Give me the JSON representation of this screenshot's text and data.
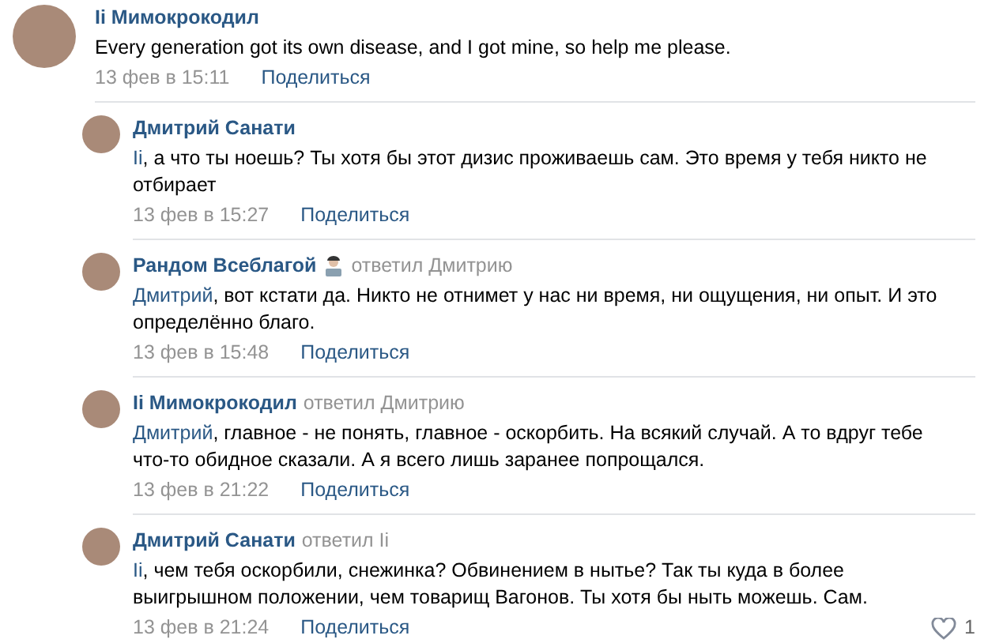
{
  "comments": [
    {
      "author": "Ii Мимокрокодил",
      "emoji": false,
      "text": "Every generation got its own disease, and I got mine, so help me please.",
      "date": "13 фев в 15:11",
      "share": "Поделиться",
      "nested": false
    },
    {
      "author": "Дмитрий Санати",
      "emoji": false,
      "addressee": "Ii",
      "text": ", а что ты ноешь? Ты хотя бы этот дизис проживаешь сам. Это время у тебя никто не отбирает",
      "date": "13 фев в 15:27",
      "share": "Поделиться",
      "nested": true
    },
    {
      "author": "Рандом Всеблагой",
      "reply_to": "ответил Дмитрию",
      "emoji": true,
      "addressee": "Дмитрий",
      "text": ", вот кстати да. Никто не отнимет у нас ни время, ни ощущения, ни опыт. И это определённо благо.",
      "date": "13 фев в 15:48",
      "share": "Поделиться",
      "nested": true
    },
    {
      "author": "Ii Мимокрокодил",
      "reply_to": "ответил Дмитрию",
      "emoji": false,
      "addressee": "Дмитрий",
      "text": ", главное - не понять, главное - оскорбить. На всякий случай. А то вдруг тебе что-то обидное сказали. А я всего лишь заранее попрощался.",
      "date": "13 фев в 21:22",
      "share": "Поделиться",
      "nested": true
    },
    {
      "author": "Дмитрий Санати",
      "reply_to": "ответил Ii",
      "emoji": false,
      "addressee": "Ii",
      "text": ", чем тебя оскорбили, снежинка? Обвинением в нытье? Так ты куда в более выигрышном положении, чем товарищ Вагонов. Ты хотя бы ныть можешь. Сам.",
      "date": "13 фев в 21:24",
      "share": "Поделиться",
      "likes": "1",
      "nested": true
    }
  ]
}
